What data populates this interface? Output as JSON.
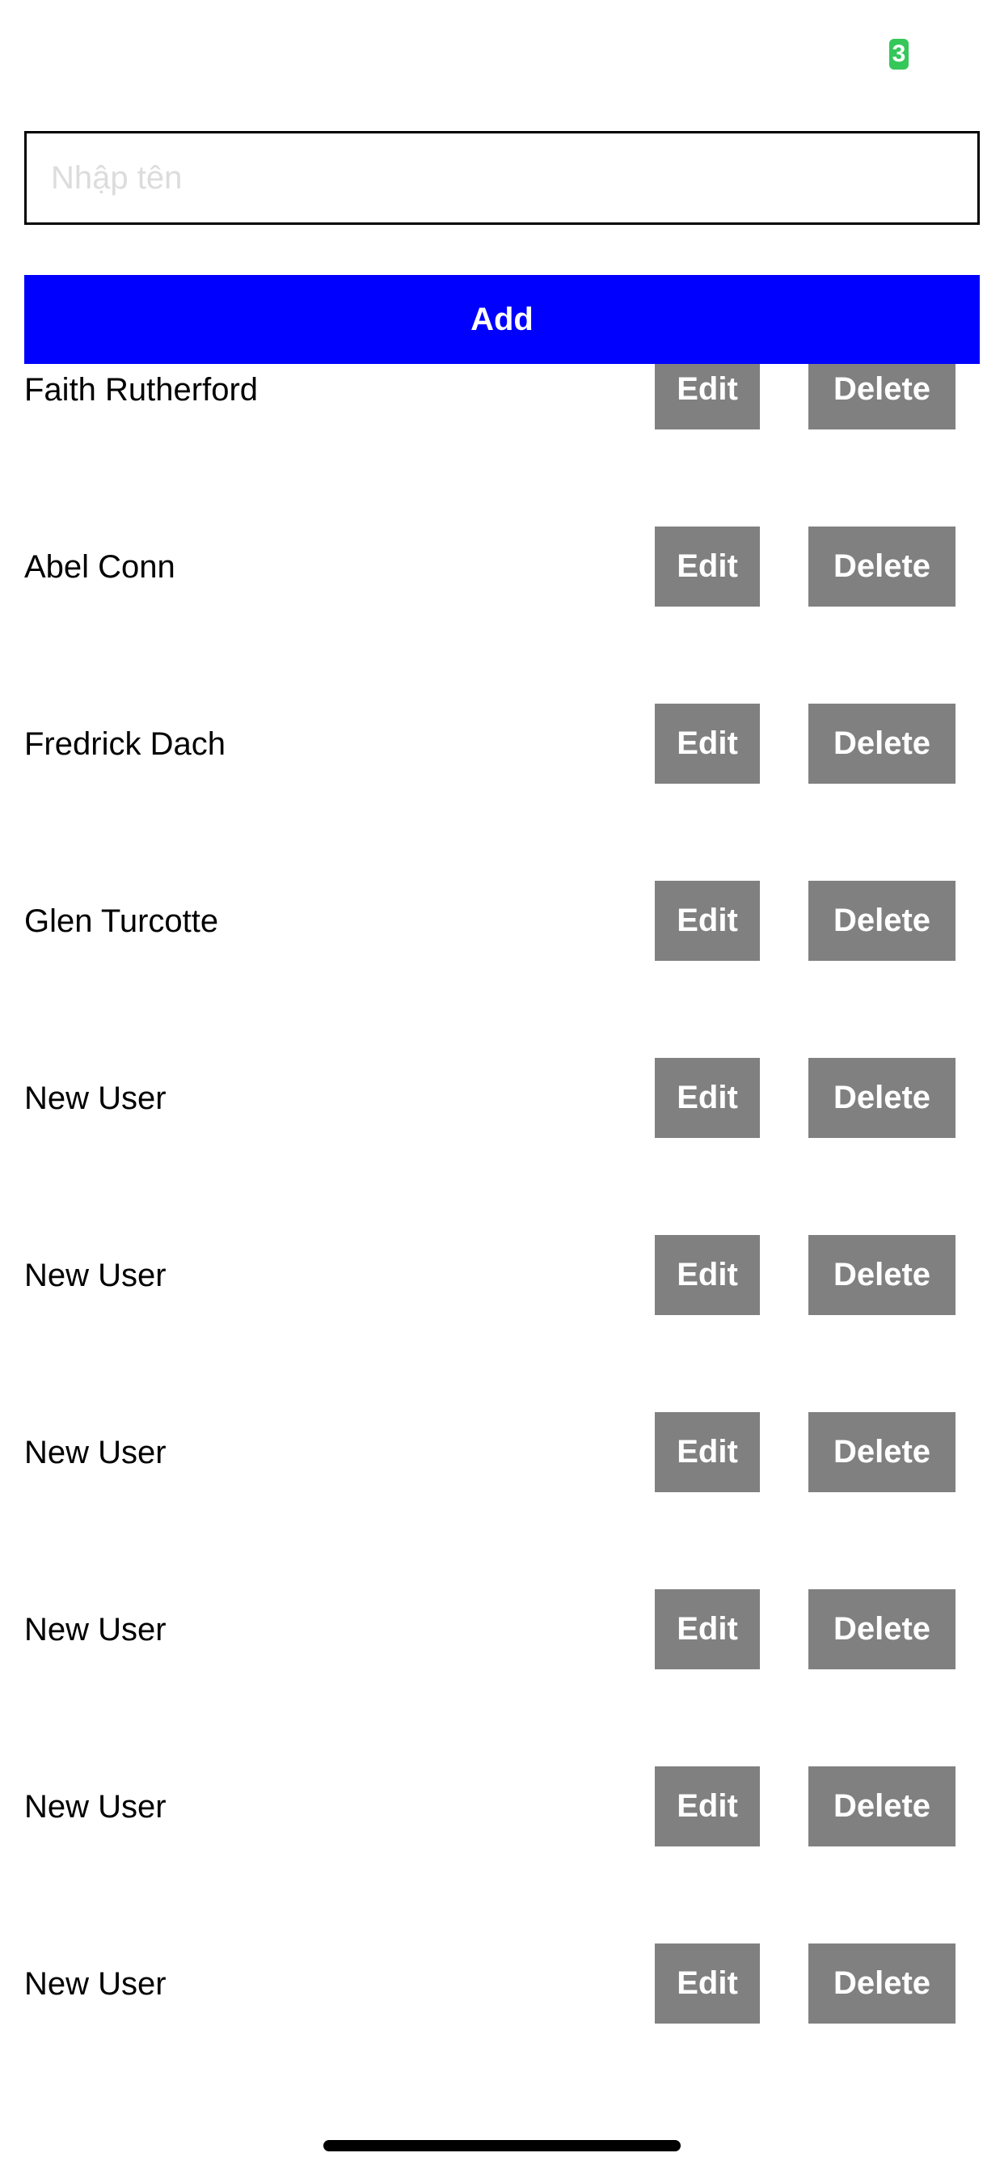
{
  "status_bar": {
    "indicator_text": "3",
    "indicator_color": "#34c759"
  },
  "form": {
    "name_input": {
      "placeholder": "Nhập tên",
      "value": ""
    },
    "add_label": "Add",
    "add_color": "#0000ff"
  },
  "users": [
    {
      "name": "Faith Rutherford",
      "edit_label": "Edit",
      "delete_label": "Delete"
    },
    {
      "name": "Abel Conn",
      "edit_label": "Edit",
      "delete_label": "Delete"
    },
    {
      "name": "Fredrick Dach",
      "edit_label": "Edit",
      "delete_label": "Delete"
    },
    {
      "name": "Glen Turcotte",
      "edit_label": "Edit",
      "delete_label": "Delete"
    },
    {
      "name": "New User",
      "edit_label": "Edit",
      "delete_label": "Delete"
    },
    {
      "name": "New User",
      "edit_label": "Edit",
      "delete_label": "Delete"
    },
    {
      "name": "New User",
      "edit_label": "Edit",
      "delete_label": "Delete"
    },
    {
      "name": "New User",
      "edit_label": "Edit",
      "delete_label": "Delete"
    },
    {
      "name": "New User",
      "edit_label": "Edit",
      "delete_label": "Delete"
    },
    {
      "name": "New User",
      "edit_label": "Edit",
      "delete_label": "Delete"
    }
  ],
  "row_button_color": "#808080"
}
